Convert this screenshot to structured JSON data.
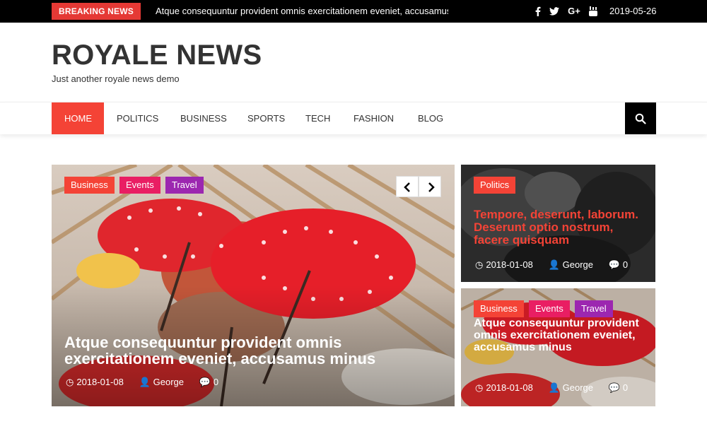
{
  "topbar": {
    "breaking_label": "BREAKING NEWS",
    "breaking_text": "Atque consequuntur provident omnis exercitationem eveniet, accusamus",
    "social": [
      "f",
      "t",
      "G+",
      "yt"
    ],
    "date": "2019-05-26"
  },
  "header": {
    "brand": "ROYALE NEWS",
    "tagline": "Just another royale news demo"
  },
  "nav": {
    "items": [
      "HOME",
      "POLITICS",
      "BUSINESS",
      "SPORTS",
      "TECH",
      "FASHION",
      "BLOG"
    ],
    "active": "HOME"
  },
  "main_card": {
    "tags": [
      "Business",
      "Events",
      "Travel"
    ],
    "title": "Atque consequuntur provident omnis exercitationem eveniet, accusamus minus",
    "date": "2018-01-08",
    "author": "George",
    "comments": "0"
  },
  "side_card_1": {
    "tags": [
      "Politics"
    ],
    "title": "Tempore, deserunt, laborum. Deserunt optio nostrum, facere quisquam",
    "date": "2018-01-08",
    "author": "George",
    "comments": "0"
  },
  "side_card_2": {
    "tags": [
      "Business",
      "Events",
      "Travel"
    ],
    "title": "Atque consequuntur provident omnis exercitationem eveniet, accusamus minus",
    "date": "2018-01-08",
    "author": "George",
    "comments": "0"
  },
  "colors": {
    "accent": "#f44336",
    "pink": "#e91e63",
    "purple": "#9c27b0",
    "topbar": "#000000"
  },
  "icons": [
    "facebook-icon",
    "twitter-icon",
    "google-plus-icon",
    "youtube-icon",
    "search-icon",
    "chevron-left-icon",
    "chevron-right-icon",
    "clock-icon",
    "user-icon",
    "comment-icon"
  ]
}
